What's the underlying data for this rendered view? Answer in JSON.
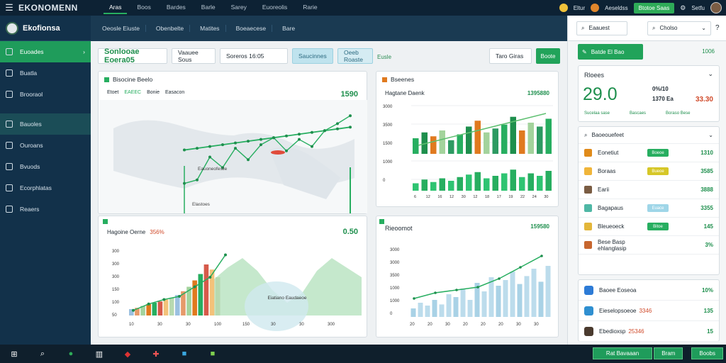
{
  "app": {
    "title": "EKONOMENN"
  },
  "topnav": [
    "Aras",
    "Boos",
    "Bardes",
    "Barle",
    "Sarey",
    "Euoreolis",
    "Rarie"
  ],
  "topright": {
    "notif": "Eltur",
    "account": "Aeseldss",
    "action_button": "Btotoe Saas",
    "user": "Setfu"
  },
  "sidebar": {
    "brand": "Ekofionsa",
    "items": [
      {
        "label": "Euoades",
        "state": "active"
      },
      {
        "label": "Buatla",
        "state": ""
      },
      {
        "label": "Brooraol",
        "state": ""
      },
      {
        "label": "Bauoles",
        "state": "sel"
      },
      {
        "label": "Ouroans",
        "state": ""
      },
      {
        "label": "Bvuods",
        "state": ""
      },
      {
        "label": "Ecorphlatas",
        "state": ""
      },
      {
        "label": "Reaers",
        "state": ""
      }
    ]
  },
  "subnav": [
    "Oeosle Eiuste",
    "Obenbelte",
    "Matites",
    "Boeaecese",
    "Bare"
  ],
  "filters": {
    "primary": "Sonlooae Eoera05",
    "select1": "Vaauee Sous",
    "select2": "Soreros 16:05",
    "tab_active": "Saucinnes",
    "tab_inactive": "Oeeb Roaste",
    "link": "Eusle",
    "right_field": "Taro Giras",
    "right_button": "Boote"
  },
  "cards": {
    "c1": {
      "title": "Bisocine Beelo",
      "value": "1590",
      "legend": [
        "Etoet",
        "EAEEC",
        "Bonie",
        "Easacon"
      ],
      "annot_mid": "Eauoneofeslie",
      "annot_low": "Elastoes"
    },
    "c2": {
      "title": "Bseenes",
      "subtitle": "Hagtane Daenk",
      "value": "1395880"
    },
    "c3": {
      "title": "Hagoine Oerne",
      "delta": "356%",
      "value": "0.50",
      "annot": "Eiatiano Eaudaeoe"
    },
    "c4": {
      "title": "Rieoomot",
      "value": "159580"
    }
  },
  "right": {
    "search": "Eaauest",
    "select": "Cholso",
    "green_button": "Batde El Bao",
    "green_value": "1006",
    "kpi": {
      "title": "Rloees",
      "value": "29.0",
      "stat1_label": "0%/10",
      "stat1_value": "1370 Ea",
      "stat2_value": "33.30",
      "sub": [
        "Sucelaa sase",
        "Bascaes",
        "Boraso Bese"
      ]
    },
    "list_title": "Baoeouefeet",
    "list": [
      {
        "label": "Eonetiut",
        "pill": "Boeoe",
        "pill_color": "#27ae60",
        "value": "1310",
        "icon_color": "#e08b1a"
      },
      {
        "label": "Boraas",
        "pill": "Bueoe",
        "pill_color": "#d6c728",
        "value": "3585",
        "icon_color": "#f0b53a"
      },
      {
        "label": "Earii",
        "pill": "",
        "pill_color": "",
        "value": "3888",
        "icon_color": "#7a5c43"
      },
      {
        "label": "Bagapaus",
        "pill": "Euace",
        "pill_color": "#9fd6e8",
        "value": "3355",
        "icon_color": "#4fb7a5"
      },
      {
        "label": "Bleueoeck",
        "pill": "Bitoe",
        "pill_color": "#27ae60",
        "value": "145",
        "icon_color": "#e3b63a"
      },
      {
        "label": "Bese Basp ehlanglasip",
        "pill": "",
        "pill_color": "",
        "value": "3%",
        "icon_color": "#c7662e"
      }
    ],
    "bottom": [
      {
        "label": "Baoee Eoseoa",
        "delta": "",
        "value": "10%",
        "icon_color": "#2d7bd6"
      },
      {
        "label": "Eieselopsoeoe",
        "delta": "3346",
        "value": "135",
        "icon_color": "#2f8fd0"
      },
      {
        "label": "Ebedioxsp",
        "delta": "25346",
        "value": "15",
        "icon_color": "#4a3a2e"
      }
    ]
  },
  "taskbar": {
    "tray": [
      "Rat Bavaaan",
      "Bram",
      "Boobs"
    ]
  },
  "chart_data": [
    {
      "type": "line",
      "title": "Bisocine Beelo",
      "x": [
        1,
        2,
        3,
        4,
        5,
        6,
        7,
        8,
        9,
        10,
        11,
        12,
        13,
        14
      ],
      "series": [
        {
          "name": "",
          "values": [
            18,
            22,
            48,
            36,
            58,
            45,
            62,
            70,
            55,
            68,
            60,
            78,
            86,
            95
          ]
        },
        {
          "name": "",
          "values": [
            56,
            58,
            60,
            62,
            64,
            66,
            68,
            70,
            72,
            74,
            76,
            78,
            80,
            82
          ]
        }
      ]
    },
    {
      "type": "bar",
      "title": "Hagtane Daenk",
      "yticks": [
        "3000",
        "3500",
        "1500",
        "1000",
        "0"
      ],
      "xticks": [
        "6",
        "12",
        "16",
        "12",
        "30",
        "12",
        "18",
        "17",
        "19",
        "22",
        "24",
        "30"
      ],
      "values_top": [
        40,
        55,
        45,
        60,
        35,
        50,
        70,
        85,
        55,
        65,
        75,
        95,
        60,
        80,
        70,
        90
      ],
      "values_bottom": [
        30,
        45,
        35,
        50,
        40,
        55,
        65,
        75,
        50,
        60,
        70,
        85,
        55,
        70,
        60,
        80
      ],
      "trend": [
        20,
        35,
        50,
        65,
        80,
        95
      ]
    },
    {
      "type": "bar",
      "title": "Hagoine Oerne",
      "yticks": [
        "300",
        "300",
        "300",
        "150",
        "100",
        "50"
      ],
      "xticks": [
        "10",
        "30",
        "30",
        "100",
        "150",
        "30",
        "30",
        "300"
      ],
      "values": [
        10,
        12,
        15,
        18,
        20,
        22,
        25,
        28,
        32,
        38,
        45,
        55,
        65,
        80,
        72,
        60
      ],
      "trend": [
        8,
        18,
        25,
        30,
        45,
        60,
        95
      ],
      "area": [
        55,
        75,
        90,
        70,
        40,
        20,
        35,
        70,
        90,
        75,
        60
      ]
    },
    {
      "type": "bar",
      "title": "Rieoomot",
      "yticks": [
        "3000",
        "3000",
        "3500",
        "1000",
        "1000",
        "0"
      ],
      "xticks": [
        "20",
        "20",
        "30",
        "20",
        "20",
        "20",
        "30",
        "30"
      ],
      "values": [
        15,
        25,
        20,
        30,
        22,
        40,
        35,
        50,
        30,
        60,
        45,
        70,
        55,
        65,
        80,
        58,
        72,
        85,
        62,
        90
      ],
      "trend": [
        20,
        30,
        35,
        40,
        55,
        75,
        95
      ]
    }
  ]
}
